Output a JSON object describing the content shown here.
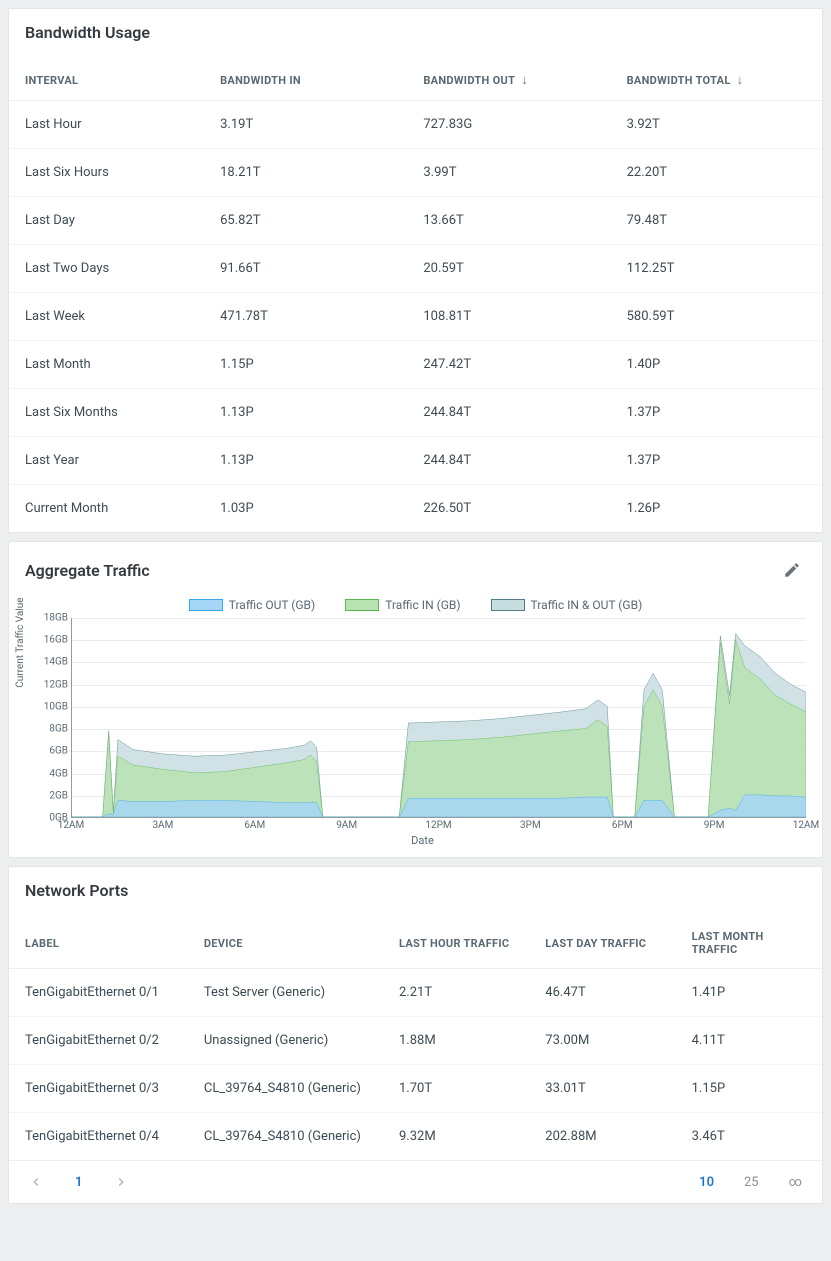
{
  "bandwidth": {
    "title": "Bandwidth Usage",
    "headers": {
      "interval": "INTERVAL",
      "in": "BANDWIDTH IN",
      "out": "BANDWIDTH OUT",
      "total": "BANDWIDTH TOTAL"
    },
    "rows": [
      {
        "interval": "Last Hour",
        "in": "3.19T",
        "out": "727.83G",
        "total": "3.92T"
      },
      {
        "interval": "Last Six Hours",
        "in": "18.21T",
        "out": "3.99T",
        "total": "22.20T"
      },
      {
        "interval": "Last Day",
        "in": "65.82T",
        "out": "13.66T",
        "total": "79.48T"
      },
      {
        "interval": "Last Two Days",
        "in": "91.66T",
        "out": "20.59T",
        "total": "112.25T"
      },
      {
        "interval": "Last Week",
        "in": "471.78T",
        "out": "108.81T",
        "total": "580.59T"
      },
      {
        "interval": "Last Month",
        "in": "1.15P",
        "out": "247.42T",
        "total": "1.40P"
      },
      {
        "interval": "Last Six Months",
        "in": "1.13P",
        "out": "244.84T",
        "total": "1.37P"
      },
      {
        "interval": "Last Year",
        "in": "1.13P",
        "out": "244.84T",
        "total": "1.37P"
      },
      {
        "interval": "Current Month",
        "in": "1.03P",
        "out": "226.50T",
        "total": "1.26P"
      }
    ]
  },
  "traffic": {
    "title": "Aggregate Traffic",
    "legend": {
      "out": "Traffic OUT (GB)",
      "in": "Traffic IN (GB)",
      "both": "Traffic IN & OUT (GB)"
    },
    "colors": {
      "out_fill": "#a6d6f5",
      "out_stroke": "#3aa7e8",
      "in_fill": "#b8e2b1",
      "in_stroke": "#57b84e",
      "both_fill": "#c8dde0",
      "both_stroke": "#4f7c87"
    },
    "ylabel": "Current Traffic Value",
    "xlabel": "Date"
  },
  "ports": {
    "title": "Network Ports",
    "headers": {
      "label": "LABEL",
      "device": "DEVICE",
      "hour": "LAST HOUR TRAFFIC",
      "day": "LAST DAY TRAFFIC",
      "month": "LAST MONTH TRAFFIC"
    },
    "rows": [
      {
        "label": "TenGigabitEthernet 0/1",
        "device": "Test Server (Generic)",
        "hour": "2.21T",
        "day": "46.47T",
        "month": "1.41P"
      },
      {
        "label": "TenGigabitEthernet 0/2",
        "device": "Unassigned (Generic)",
        "hour": "1.88M",
        "day": "73.00M",
        "month": "4.11T"
      },
      {
        "label": "TenGigabitEthernet 0/3",
        "device": "CL_39764_S4810 (Generic)",
        "hour": "1.70T",
        "day": "33.01T",
        "month": "1.15P"
      },
      {
        "label": "TenGigabitEthernet 0/4",
        "device": "CL_39764_S4810 (Generic)",
        "hour": "9.32M",
        "day": "202.88M",
        "month": "3.46T"
      }
    ],
    "pager": {
      "page": "1",
      "sizes": [
        "10",
        "25",
        "∞"
      ],
      "active_size": "10"
    }
  },
  "chart_data": {
    "type": "area",
    "xlabel": "Date",
    "ylabel": "Current Traffic Value",
    "ylim": [
      0,
      18
    ],
    "yticks": [
      "0GB",
      "2GB",
      "4GB",
      "6GB",
      "8GB",
      "10GB",
      "12GB",
      "14GB",
      "16GB",
      "18GB"
    ],
    "xticks": [
      "12AM",
      "3AM",
      "6AM",
      "9AM",
      "12PM",
      "3PM",
      "6PM",
      "9PM",
      "12AM"
    ],
    "x": [
      0,
      0.5,
      1,
      1.2,
      1.35,
      1.5,
      2,
      3,
      4,
      5,
      6,
      7,
      7.6,
      7.8,
      8,
      8.2,
      8.5,
      9,
      10,
      10.7,
      11,
      12,
      13,
      14,
      15,
      16,
      16.8,
      17.2,
      17.5,
      17.7,
      18,
      18.4,
      18.7,
      19,
      19.3,
      19.7,
      20,
      20.3,
      20.8,
      21.2,
      21.5,
      21.7,
      22,
      22.5,
      23,
      23.5,
      24
    ],
    "series": [
      {
        "name": "Traffic IN & OUT (GB)",
        "color_fill": "#c8dde0",
        "color_stroke": "#4f7c87",
        "values": [
          0,
          0,
          0,
          7.8,
          0.5,
          7,
          6.1,
          5.7,
          5.5,
          5.6,
          5.9,
          6.2,
          6.5,
          6.9,
          6.3,
          0,
          0,
          0,
          0,
          0,
          8.5,
          8.6,
          8.7,
          8.9,
          9.2,
          9.5,
          9.8,
          10.6,
          10,
          0,
          0,
          0,
          11.5,
          13,
          11.5,
          0,
          0,
          0,
          0,
          16.4,
          11,
          16.6,
          15.5,
          14.5,
          13,
          12,
          11.3
        ]
      },
      {
        "name": "Traffic IN (GB)",
        "color_fill": "#b8e2b1",
        "color_stroke": "#57b84e",
        "values": [
          0,
          0,
          0,
          7.5,
          0.3,
          5.5,
          4.7,
          4.3,
          4.0,
          4.1,
          4.5,
          4.9,
          5.2,
          5.6,
          5.0,
          0,
          0,
          0,
          0,
          0,
          6.8,
          6.9,
          7.0,
          7.2,
          7.5,
          7.8,
          8.0,
          8.8,
          8.2,
          0,
          0,
          0,
          10.0,
          11.5,
          10.0,
          0,
          0,
          0,
          0,
          15.8,
          10.2,
          16.0,
          13.5,
          12.5,
          11,
          10.2,
          9.5
        ]
      },
      {
        "name": "Traffic OUT (GB)",
        "color_fill": "#a6d6f5",
        "color_stroke": "#3aa7e8",
        "values": [
          0,
          0,
          0,
          0.3,
          0.2,
          1.5,
          1.4,
          1.4,
          1.5,
          1.5,
          1.4,
          1.3,
          1.3,
          1.3,
          1.3,
          0,
          0,
          0,
          0,
          0,
          1.7,
          1.7,
          1.7,
          1.7,
          1.7,
          1.7,
          1.8,
          1.8,
          1.8,
          0,
          0,
          0,
          1.5,
          1.5,
          1.5,
          0,
          0,
          0,
          0,
          0.6,
          0.8,
          0.6,
          2.0,
          2.0,
          1.9,
          1.9,
          1.8
        ]
      }
    ]
  }
}
